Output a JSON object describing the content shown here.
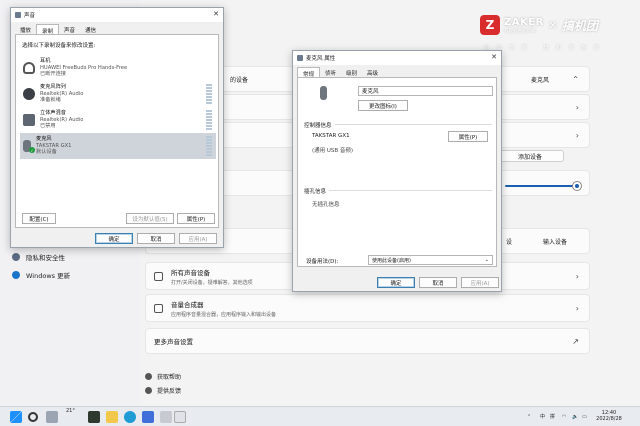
{
  "settings": {
    "nav": [
      {
        "label": "隐私和安全性"
      },
      {
        "label": "Windows 更新"
      }
    ],
    "cards": {
      "card1": {
        "text": "的设备",
        "value": "麦克风"
      },
      "card3_button": "添加设备",
      "card5_button": "输入设备",
      "all_devices": {
        "title": "所有声音设备",
        "sub": "打开/关闭设备，疑难解答，其他选项"
      },
      "mixer": {
        "title": "音量合成器",
        "sub": "应用程序音量混合器，应用程序输入和输出设备"
      },
      "more": {
        "title": "更多声音设置"
      }
    },
    "help": [
      {
        "label": "获取帮助"
      },
      {
        "label": "提供反馈"
      }
    ]
  },
  "watermark": {
    "brand": "ZAKER",
    "tagline": "有趣好看的新闻",
    "partner": "搞机团",
    "slogan": "由 识 玩 家 · 玩 机 有 板 有"
  },
  "sound_dialog": {
    "title": "声音",
    "tabs": [
      "播放",
      "录制",
      "声音",
      "通信"
    ],
    "active_tab": 1,
    "instruction": "选择以下录制设备来修改设置:",
    "devices": [
      {
        "name": "耳机",
        "desc": "HUAWEI FreeBuds Pro Hands-Free",
        "status": "已断开连接",
        "icon": "headset-icon",
        "selected": false
      },
      {
        "name": "麦克风阵列",
        "desc": "Realtek(R) Audio",
        "status": "准备就绪",
        "icon": "mic-array-icon",
        "selected": false
      },
      {
        "name": "立体声混音",
        "desc": "Realtek(R) Audio",
        "status": "已禁用",
        "icon": "stereo-mix-icon",
        "selected": false
      },
      {
        "name": "麦克风",
        "desc": "TAKSTAR GX1",
        "status": "默认设备",
        "icon": "microphone-icon",
        "selected": true
      }
    ],
    "buttons": {
      "configure": "配置(C)",
      "set_default": "设为默认值(S)",
      "properties": "属性(P)",
      "ok": "确定",
      "cancel": "取消",
      "apply": "应用(A)"
    }
  },
  "props_dialog": {
    "title": "麦克风 属性",
    "tabs": [
      "常规",
      "侦听",
      "级别",
      "高级"
    ],
    "active_tab": 0,
    "device_name": "麦克风",
    "change_icon": "更改图标(I)",
    "controller_label": "控制器信息",
    "controller_name": "TAKSTAR GX1",
    "controller_props": "属性(P)",
    "controller_desc": "(通用 USB 音频)",
    "jack_label": "插孔信息",
    "jack_value": "无插孔信息",
    "usage_label": "设备用法(D):",
    "usage_value": "使用此设备(启用)",
    "ok": "确定",
    "cancel": "取消",
    "apply": "应用(A)"
  },
  "taskbar": {
    "tray_lang": "中",
    "tray_ime": "拼",
    "time": "12:40",
    "date": "2022/8/28",
    "weather": "21°"
  }
}
